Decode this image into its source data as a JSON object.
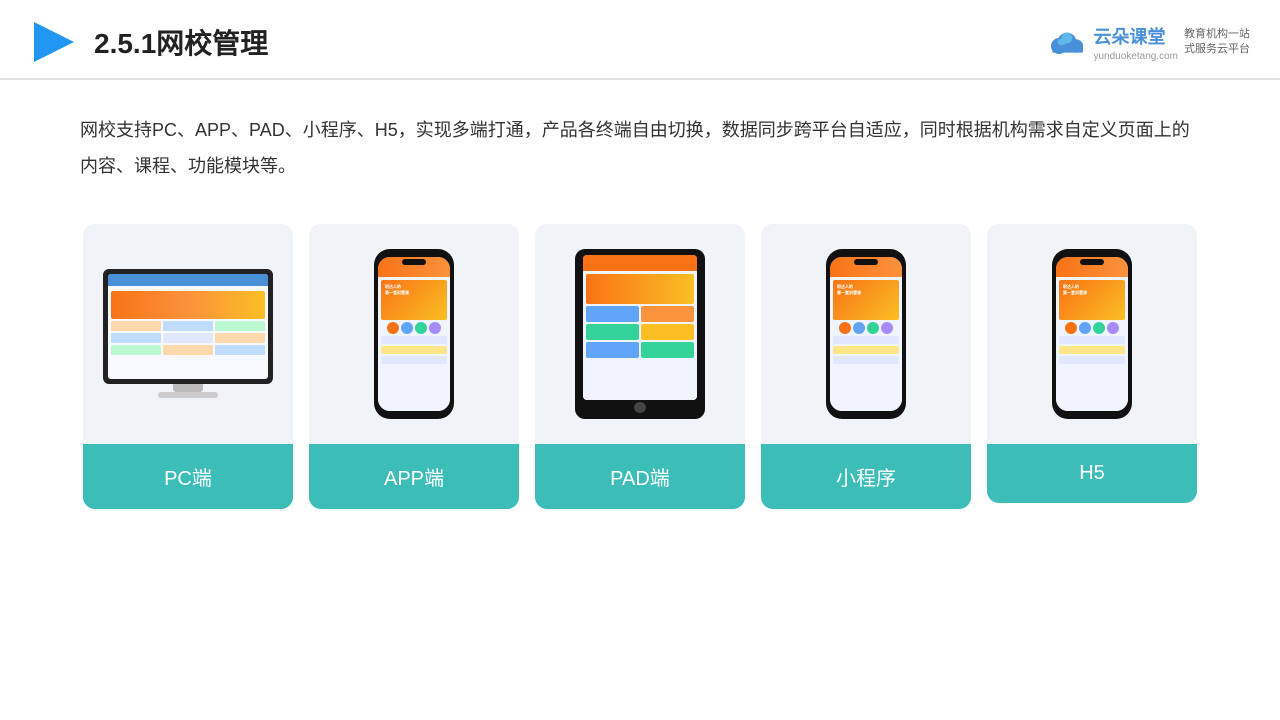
{
  "header": {
    "title": "2.5.1网校管理",
    "logo_main": "云朵课堂",
    "logo_url": "yunduoketang.com",
    "logo_tagline_line1": "教育机构一站",
    "logo_tagline_line2": "式服务云平台"
  },
  "description": {
    "text": "网校支持PC、APP、PAD、小程序、H5，实现多端打通，产品各终端自由切换，数据同步跨平台自适应，同时根据机构需求自定义页面上的内容、课程、功能模块等。"
  },
  "cards": [
    {
      "id": "pc",
      "label": "PC端"
    },
    {
      "id": "app",
      "label": "APP端"
    },
    {
      "id": "pad",
      "label": "PAD端"
    },
    {
      "id": "miniprogram",
      "label": "小程序"
    },
    {
      "id": "h5",
      "label": "H5"
    }
  ],
  "colors": {
    "teal": "#3dbdb8",
    "accent_blue": "#4a90d9",
    "card_bg": "#f0f4f8"
  }
}
